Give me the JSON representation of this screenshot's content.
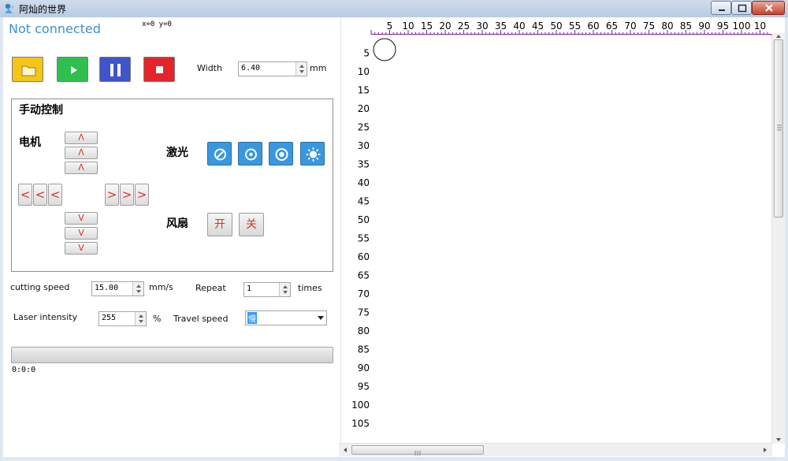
{
  "window": {
    "title": "阿灿的世界",
    "controls": [
      "minimize",
      "maximize",
      "close"
    ]
  },
  "status": {
    "connection": "Not connected",
    "coords": "x=0  y=0"
  },
  "toolbar": {
    "buttons": [
      {
        "name": "open-folder",
        "color": "#f5c518"
      },
      {
        "name": "start",
        "color": "#2fbf4e"
      },
      {
        "name": "pause",
        "color": "#3f55c9"
      },
      {
        "name": "stop",
        "color": "#e4242a"
      }
    ],
    "width_label": "Width",
    "width_value": "6.40",
    "width_unit": "mm"
  },
  "manual": {
    "title": "手动控制",
    "motor_label": "电机",
    "up": "Λ",
    "down": "V",
    "left": "<",
    "right": ">",
    "laser_label": "激光",
    "laser_buttons": [
      "laser-off",
      "laser-low",
      "laser-focus",
      "laser-on"
    ],
    "fan_label": "风扇",
    "fan_on": "开",
    "fan_off": "关"
  },
  "settings": {
    "cutting_speed_label": "cutting speed",
    "cutting_speed_value": "15.00",
    "cutting_speed_unit": "mm/s",
    "repeat_label": "Repeat",
    "repeat_value": "1",
    "repeat_unit": "times",
    "laser_intensity_label": "Laser intensity",
    "laser_intensity_value": "255",
    "laser_intensity_unit": "%",
    "travel_speed_label": "Travel speed",
    "travel_speed_value": "慢"
  },
  "progress": {
    "fraction": 0,
    "elapsed": "0:0:0"
  },
  "ruler": {
    "top_labels": [
      "5",
      "10",
      "15",
      "20",
      "25",
      "30",
      "35",
      "40",
      "45",
      "50",
      "55",
      "60",
      "65",
      "70",
      "75",
      "80",
      "85",
      "90",
      "95",
      "100",
      "10"
    ],
    "left_labels": [
      "5",
      "10",
      "15",
      "20",
      "25",
      "30",
      "35",
      "40",
      "45",
      "50",
      "55",
      "60",
      "65",
      "70",
      "75",
      "80",
      "85",
      "90",
      "95",
      "100",
      "105"
    ],
    "color": "#7a1fa2"
  }
}
